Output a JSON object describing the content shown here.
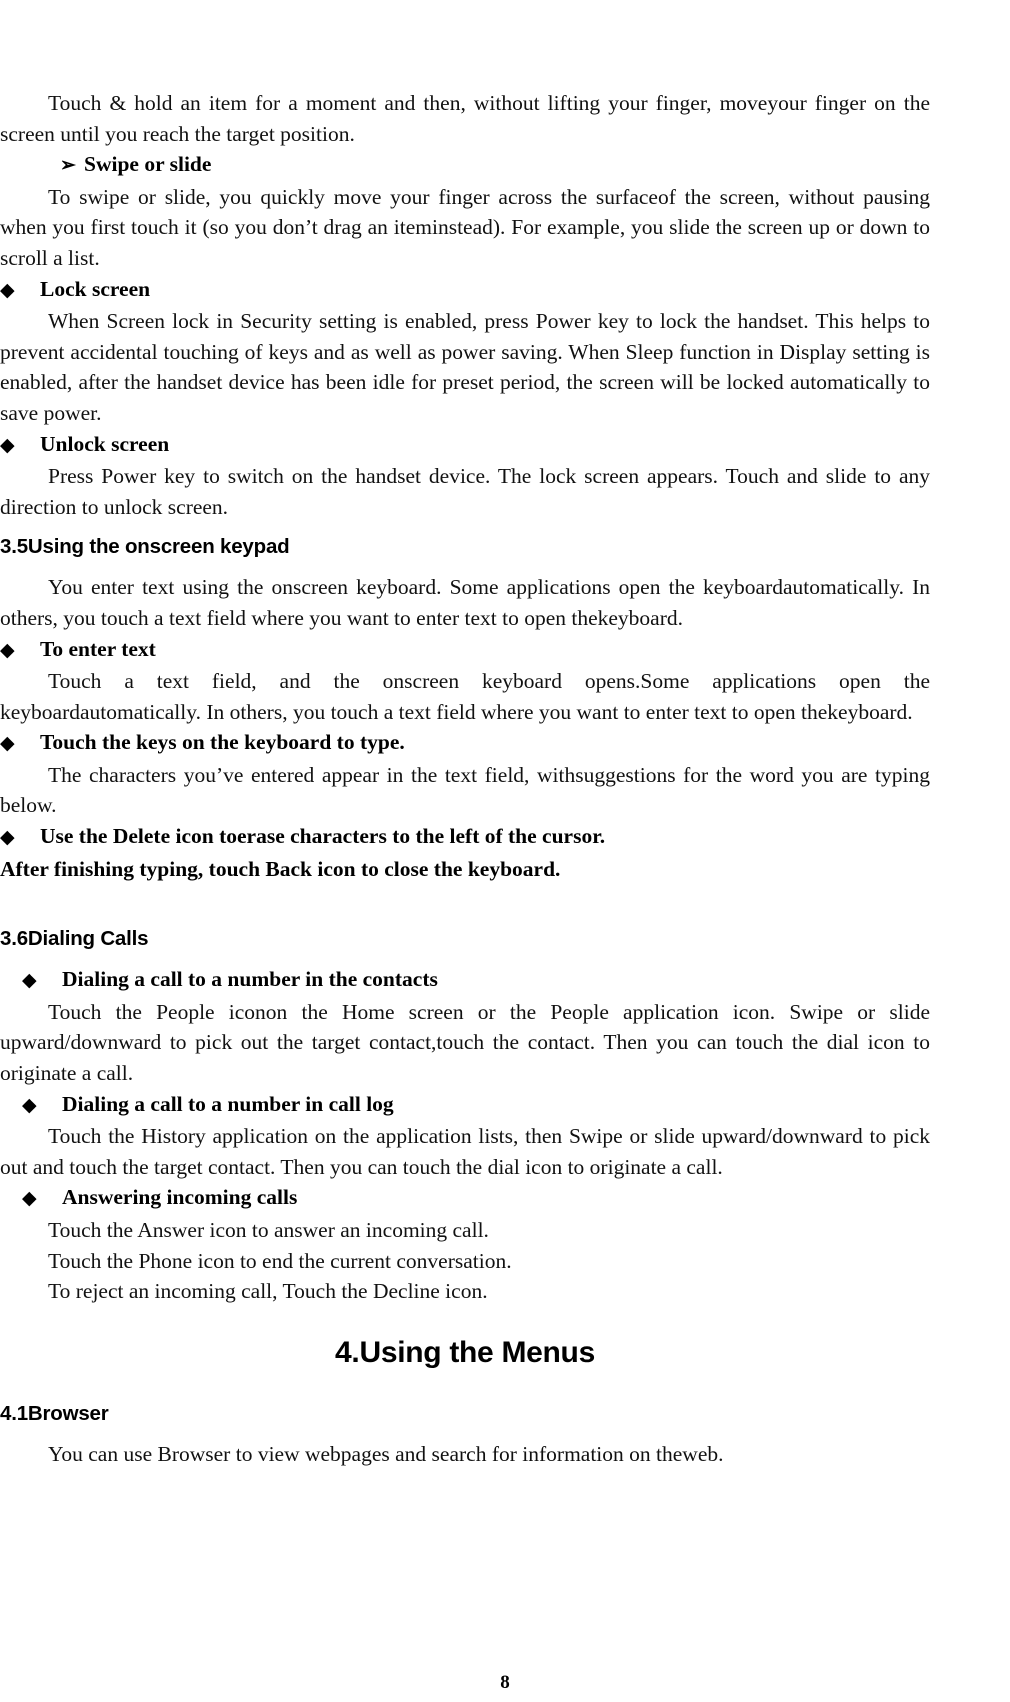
{
  "document": {
    "page_number": "8",
    "markers": {
      "diamond": "◆",
      "arrow": "➢"
    }
  },
  "blocks": {
    "touch_hold_paragraph": "Touch & hold an item for a moment and then, without lifting your finger, moveyour finger on the screen until you reach the target position.",
    "swipe_or_slide_heading": "Swipe or slide",
    "swipe_or_slide_paragraph": "To swipe or slide, you quickly move your finger across the surfaceof the screen, without pausing when you first touch it (so you don’t drag an iteminstead). For example, you slide the screen up or down to scroll a list.",
    "lock_screen_heading": "Lock screen",
    "lock_screen_paragraph": "When Screen lock in Security setting is enabled, press Power key to lock the handset. This helps to prevent accidental touching of keys and as well as power saving.    When Sleep function in Display setting is enabled, after the handset device has been idle for preset period, the screen will be locked automatically to save power.",
    "unlock_screen_heading": "Unlock screen",
    "unlock_screen_paragraph": "Press Power key to switch on the handset device. The lock screen appears. Touch and slide to any direction to unlock screen.",
    "section_3_5_heading": "3.5Using the onscreen keypad",
    "section_3_5_paragraph": "You enter text using the onscreen keyboard. Some applications open the keyboardautomatically. In others, you touch a text field where you want to enter text to open thekeyboard.",
    "to_enter_text_heading": "To enter text",
    "to_enter_text_paragraph": "Touch a text field, and the onscreen keyboard opens.Some applications open the keyboardautomatically. In others, you touch a text field where you want to enter text to open thekeyboard.",
    "touch_keys_heading": "Touch the keys on the keyboard to type.",
    "touch_keys_paragraph": "The characters you’ve entered appear in the text field, withsuggestions for the word you are typing below.",
    "delete_icon_heading": "Use the Delete icon toerase characters to the left of the cursor.",
    "after_finishing_line": "After finishing typing, touch Back icon to close the keyboard.",
    "section_3_6_heading": "3.6Dialing Calls",
    "dialing_contacts_heading": "Dialing a call to a number in the contacts",
    "dialing_contacts_paragraph": "Touch the People iconon the Home screen or the People application icon. Swipe or slide upward/downward to pick out the target contact,touch the contact. Then you can touch the dial icon to originate a call.",
    "dialing_call_log_heading": "Dialing a call to a number in call log",
    "dialing_call_log_paragraph": "Touch the History application on the application lists, then Swipe or slide upward/downward to pick out and touch the target contact. Then you can touch the dial icon to originate a call.",
    "answering_calls_heading": "Answering incoming calls",
    "answering_line_1": "Touch the Answer icon to answer an incoming call.",
    "answering_line_2": "Touch the Phone icon to end the current conversation.",
    "answering_line_3": "To reject an incoming call, Touch the Decline icon.",
    "chapter_4_heading": "4.Using the Menus",
    "section_4_1_heading": "4.1Browser",
    "section_4_1_paragraph": "You can use Browser to view webpages and search for information on theweb."
  }
}
